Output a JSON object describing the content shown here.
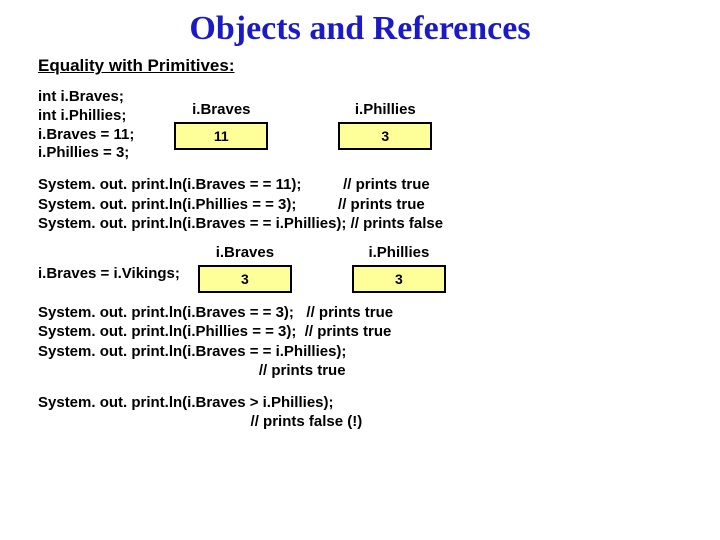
{
  "title": "Objects and References",
  "subtitle": "Equality with Primitives:",
  "decl": {
    "l1": "int i.Braves;",
    "l2": "int i.Phillies;",
    "l3": "i.Braves = 11;",
    "l4": "i.Phillies = 3;"
  },
  "diagA": {
    "left_label": "i.Braves",
    "left_value": "11",
    "right_label": "i.Phillies",
    "right_value": "3"
  },
  "blockA": {
    "l1": "System. out. print.ln(i.Braves = = 11);          // prints true",
    "l2": "System. out. print.ln(i.Phillies = = 3);          // prints true",
    "l3": "System. out. print.ln(i.Braves = = i.Phillies); // prints false"
  },
  "assign2": "i.Braves = i.Vikings;",
  "diagB": {
    "left_label": "i.Braves",
    "left_value": "3",
    "right_label": "i.Phillies",
    "right_value": "3"
  },
  "blockB": {
    "l1": "System. out. print.ln(i.Braves = = 3);   // prints true",
    "l2": "System. out. print.ln(i.Phillies = = 3);  // prints true",
    "l3": "System. out. print.ln(i.Braves = = i.Phillies);",
    "l4": "                                                     // prints true"
  },
  "blockC": {
    "l1": "System. out. print.ln(i.Braves > i.Phillies);",
    "l2": "                                                   // prints false (!)"
  }
}
